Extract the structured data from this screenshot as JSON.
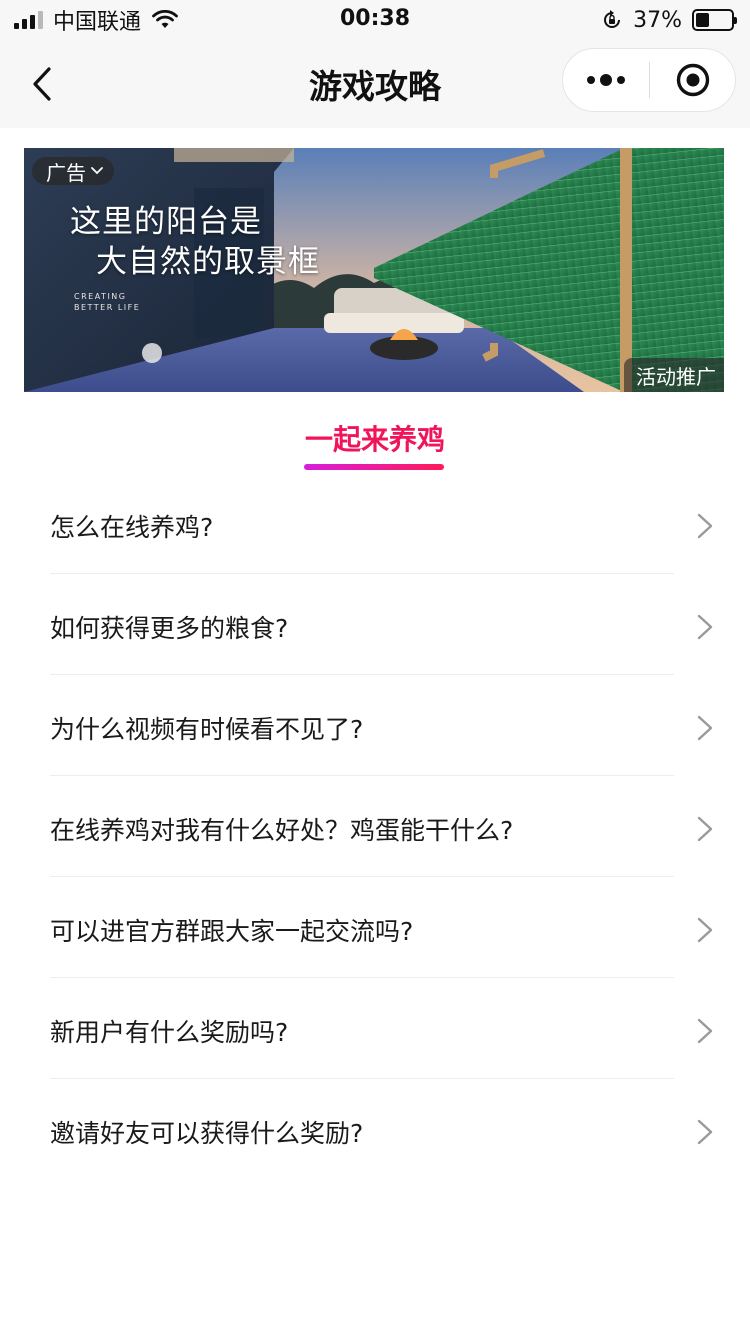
{
  "status_bar": {
    "carrier": "中国联通",
    "time": "00:38",
    "battery_percent_label": "37%",
    "battery_level": 0.37,
    "icons": [
      "signal-icon",
      "wifi-icon",
      "rotation-lock-icon",
      "battery-icon"
    ]
  },
  "title_bar": {
    "title": "游戏攻略",
    "icons": [
      "back-chevron-icon",
      "more-dots-icon",
      "close-target-icon"
    ]
  },
  "banner": {
    "ad_badge": "广告",
    "headline_line1": "这里的阳台是",
    "headline_line2": "大自然的取景框",
    "brand_line1": "CREATING",
    "brand_line2": "BETTER LIFE",
    "promo_label": "活动推广"
  },
  "section": {
    "title": "一起来养鸡",
    "accent_color": "#f0145a"
  },
  "faq": {
    "items": [
      "怎么在线养鸡?",
      "如何获得更多的粮食?",
      "为什么视频有时候看不见了?",
      "在线养鸡对我有什么好处？鸡蛋能干什么?",
      "可以进官方群跟大家一起交流吗?",
      "新用户有什么奖励吗?",
      "邀请好友可以获得什么奖励?"
    ]
  }
}
